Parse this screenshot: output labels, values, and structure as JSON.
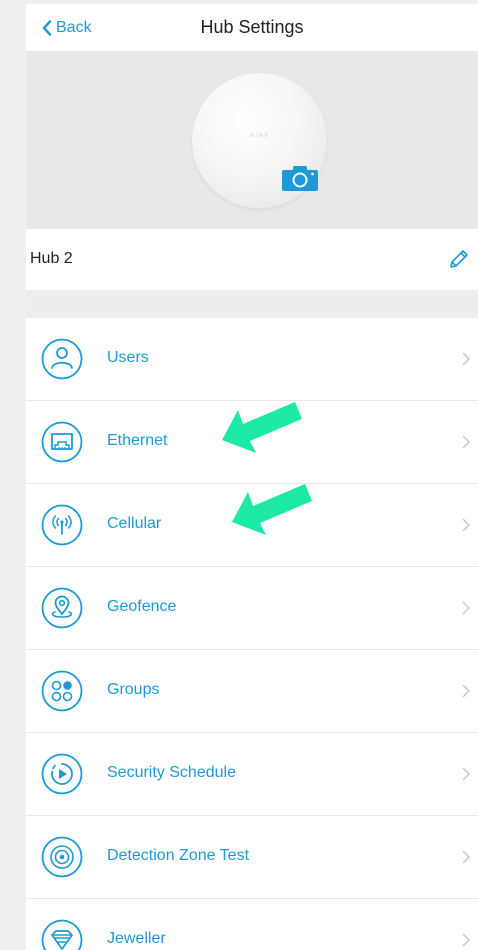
{
  "nav": {
    "back_label": "Back",
    "title": "Hub Settings"
  },
  "hero": {
    "device_logo": "AJAX",
    "camera_icon": "camera-icon"
  },
  "hub": {
    "name": "Hub 2",
    "edit_icon": "pencil-icon"
  },
  "menu": {
    "items": [
      {
        "label": "Users",
        "icon": "user-icon"
      },
      {
        "label": "Ethernet",
        "icon": "ethernet-icon"
      },
      {
        "label": "Cellular",
        "icon": "cellular-antenna-icon"
      },
      {
        "label": "Geofence",
        "icon": "location-pin-icon"
      },
      {
        "label": "Groups",
        "icon": "groups-icon"
      },
      {
        "label": "Security Schedule",
        "icon": "schedule-icon"
      },
      {
        "label": "Detection Zone Test",
        "icon": "detection-zone-icon"
      },
      {
        "label": "Jeweller",
        "icon": "jeweller-icon"
      }
    ]
  },
  "colors": {
    "accent": "#1d9ad6",
    "annotation_arrow": "#1de8a6",
    "background": "#efeff0"
  }
}
